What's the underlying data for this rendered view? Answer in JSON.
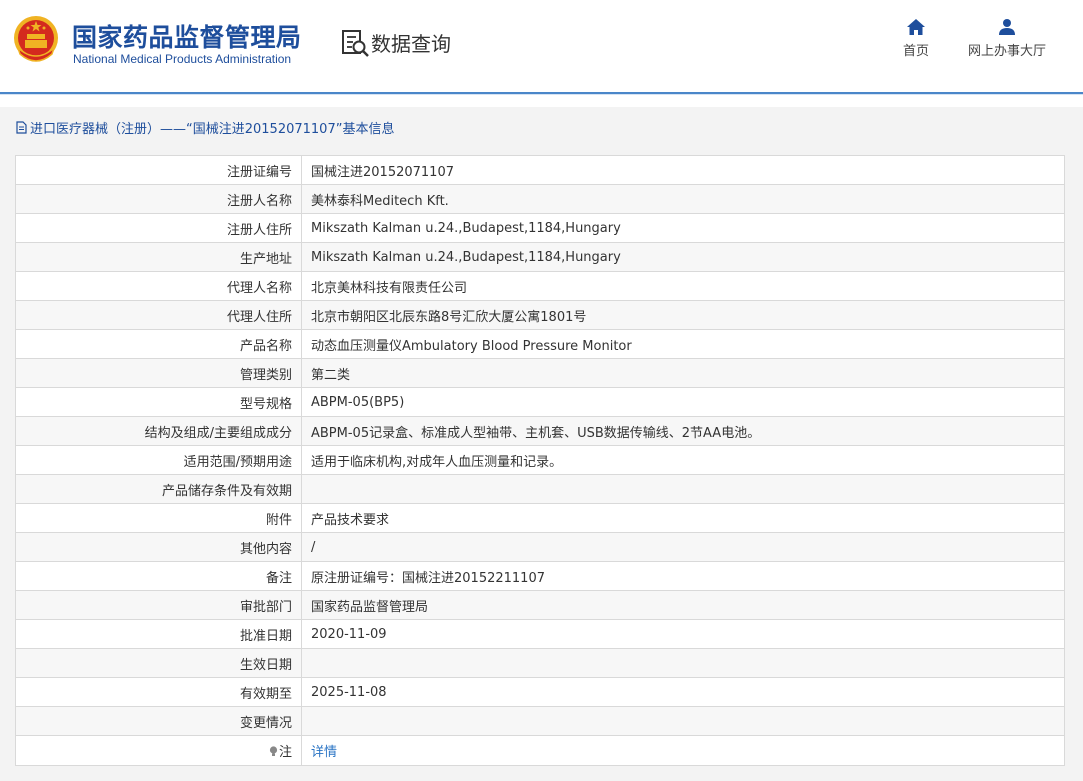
{
  "header": {
    "agency_name_cn": "国家药品监督管理局",
    "agency_name_en": "National Medical Products Administration",
    "data_query_label": "数据查询",
    "nav": {
      "home_label": "首页",
      "online_hall_label": "网上办事大厅"
    }
  },
  "breadcrumb": {
    "text": "进口医疗器械（注册）——“国械注进20152071107”基本信息"
  },
  "details": {
    "rows": [
      {
        "label": "注册证编号",
        "value": "国械注进20152071107"
      },
      {
        "label": "注册人名称",
        "value": "美林泰科Meditech Kft."
      },
      {
        "label": "注册人住所",
        "value": "Mikszath Kalman u.24.,Budapest,1184,Hungary"
      },
      {
        "label": "生产地址",
        "value": "Mikszath Kalman u.24.,Budapest,1184,Hungary"
      },
      {
        "label": "代理人名称",
        "value": "北京美林科技有限责任公司"
      },
      {
        "label": "代理人住所",
        "value": "北京市朝阳区北辰东路8号汇欣大厦公寓1801号"
      },
      {
        "label": "产品名称",
        "value": "动态血压测量仪Ambulatory Blood Pressure Monitor"
      },
      {
        "label": "管理类别",
        "value": "第二类"
      },
      {
        "label": "型号规格",
        "value": "ABPM-05(BP5)"
      },
      {
        "label": "结构及组成/主要组成成分",
        "value": "ABPM-05记录盒、标准成人型袖带、主机套、USB数据传输线、2节AA电池。"
      },
      {
        "label": "适用范围/预期用途",
        "value": "适用于临床机构,对成年人血压测量和记录。"
      },
      {
        "label": "产品储存条件及有效期",
        "value": ""
      },
      {
        "label": "附件",
        "value": "产品技术要求"
      },
      {
        "label": "其他内容",
        "value": "/"
      },
      {
        "label": "备注",
        "value": "原注册证编号：国械注进20152211107"
      },
      {
        "label": "审批部门",
        "value": "国家药品监督管理局"
      },
      {
        "label": "批准日期",
        "value": "2020-11-09"
      },
      {
        "label": "生效日期",
        "value": ""
      },
      {
        "label": "有效期至",
        "value": "2025-11-08"
      },
      {
        "label": "变更情况",
        "value": ""
      }
    ],
    "note_row": {
      "label": "注",
      "link_text": "详情"
    }
  },
  "icons": {
    "emblem": "national-emblem-icon",
    "query": "document-search-icon",
    "home": "home-icon",
    "hall": "user-icon",
    "breadcrumb": "document-icon",
    "note": "lightbulb-icon"
  },
  "colors": {
    "brand_blue": "#1e4e9c",
    "link_blue": "#2a74c4",
    "emblem_red": "#d42a1e",
    "emblem_gold": "#f0b323",
    "header_rule": "#4a86c9"
  }
}
